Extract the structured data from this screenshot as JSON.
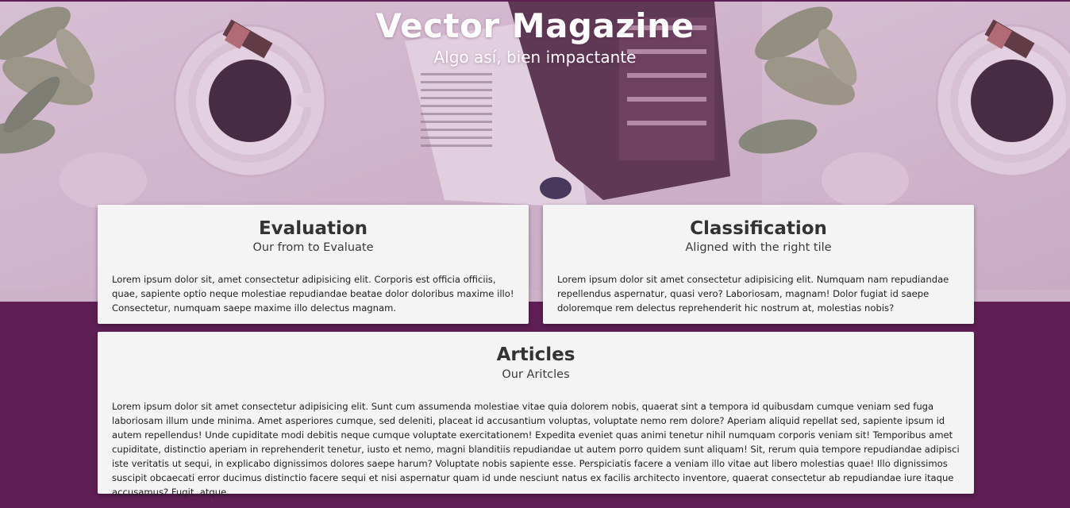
{
  "header": {
    "title": "Vector Magazine",
    "subtitle": "Algo así, bien impactante"
  },
  "cards": {
    "evaluation": {
      "title": "Evaluation",
      "subtitle": "Our from to Evaluate",
      "body": "Lorem ipsum dolor sit, amet consectetur adipisicing elit. Corporis est officia officiis, quae, sapiente optio neque molestiae repudiandae beatae dolor doloribus maxime illo! Consectetur, numquam saepe maxime illo delectus magnam."
    },
    "classification": {
      "title": "Classification",
      "subtitle": "Aligned with the right tile",
      "body": "Lorem ipsum dolor sit amet consectetur adipisicing elit. Numquam nam repudiandae repellendus aspernatur, quasi vero? Laboriosam, magnam! Dolor fugiat id saepe doloremque rem delectus reprehenderit hic nostrum at, molestias nobis?"
    },
    "articles": {
      "title": "Articles",
      "subtitle": "Our Aritcles",
      "body": "Lorem ipsum dolor sit amet consectetur adipisicing elit. Sunt cum assumenda molestiae vitae quia dolorem nobis, quaerat sint a tempora id quibusdam cumque veniam sed fuga laboriosam illum unde minima. Amet asperiores cumque, sed deleniti, placeat id accusantium voluptas, voluptate nemo rem dolore? Aperiam aliquid repellat sed, sapiente ipsum id autem repellendus! Unde cupiditate modi debitis neque cumque voluptate exercitationem! Expedita eveniet quas animi tenetur nihil numquam corporis veniam sit! Temporibus amet cupiditate, distinctio aperiam in reprehenderit tenetur, iusto et nemo, magni blanditiis repudiandae ut autem porro quidem sunt aliquam! Sit, rerum quia tempore repudiandae adipisci iste veritatis ut sequi, in explicabo dignissimos dolores saepe harum? Voluptate nobis sapiente esse. Perspiciatis facere a veniam illo vitae aut libero molestias quae! Illo dignissimos suscipit obcaecati error ducimus distinctio facere sequi et nisi aspernatur quam id unde nesciunt natus ex facilis architecto inventore, quaerat consectetur ab repudiandae iure itaque accusamus? Fugit, atque."
    }
  },
  "colors": {
    "page_background": "#5f1f55",
    "card_background": "#f4f4f4",
    "title_text": "#ffffff",
    "card_heading": "#333333"
  },
  "hero_image": {
    "icons": [
      "coffee-cup-icon",
      "magazine-image",
      "plant-leaves-icon",
      "chocolate-icon"
    ]
  }
}
